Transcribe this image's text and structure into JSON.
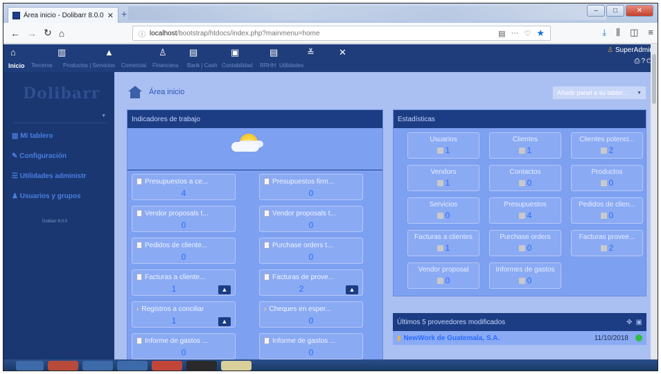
{
  "browser": {
    "tab_title": "Área inicio - Dolibarr 8.0.0",
    "url_host": "localhost",
    "url_path": "/bootstrap/htdocs/index.php?mainmenu=home"
  },
  "topmenu": {
    "items": [
      "Inicio",
      "Terceros",
      "Productos | Servicios",
      "Comercial",
      "Financiera",
      "Bank | Cash",
      "Contabilidad",
      "RRHH",
      "Utilidades"
    ],
    "user": "SuperAdmin"
  },
  "sidebar": {
    "logo": "Dolibarr",
    "items": [
      {
        "label": "Mi tablero",
        "icon": "chart-icon"
      },
      {
        "label": "Configuración",
        "icon": "wrench-icon"
      },
      {
        "label": "Utilidades administr",
        "icon": "list-icon"
      },
      {
        "label": "Usuarios y grupos",
        "icon": "users-icon"
      }
    ],
    "version": "Dolibarr 8.0.0"
  },
  "main": {
    "breadcrumb": "Área inicio",
    "add_panel_placeholder": "Añadir panel a su tabler...",
    "work_panel": {
      "title": "Indicadores de trabajo",
      "boxes": [
        {
          "label": "Presupuestos a ce...",
          "value": "4",
          "warning": false
        },
        {
          "label": "Presupuestos firm...",
          "value": "0",
          "warning": false
        },
        {
          "label": "Vendor proposals t...",
          "value": "0",
          "warning": false
        },
        {
          "label": "Vendor proposals t...",
          "value": "0",
          "warning": false
        },
        {
          "label": "Pedidos de cliente...",
          "value": "0",
          "warning": false
        },
        {
          "label": "Purchase orders t...",
          "value": "0",
          "warning": false
        },
        {
          "label": "Facturas a cliente...",
          "value": "1",
          "warning": true
        },
        {
          "label": "Facturas de prove...",
          "value": "2",
          "warning": true
        },
        {
          "label": "Registros a conciliar",
          "value": "1",
          "warning": true
        },
        {
          "label": "Cheques en esper...",
          "value": "0",
          "warning": false
        },
        {
          "label": "Informe de gastos ...",
          "value": "0",
          "warning": false
        },
        {
          "label": "Informe de gastos ...",
          "value": "0",
          "warning": false
        }
      ]
    },
    "stats_panel": {
      "title": "Estadísticas",
      "items": [
        {
          "label": "Usuarios",
          "value": "1"
        },
        {
          "label": "Clientes",
          "value": "1"
        },
        {
          "label": "Clientes potenci...",
          "value": "2"
        },
        {
          "label": "Vendors",
          "value": "1"
        },
        {
          "label": "Contactos",
          "value": "0"
        },
        {
          "label": "Productos",
          "value": "0"
        },
        {
          "label": "Servicios",
          "value": "0"
        },
        {
          "label": "Presupuestos",
          "value": "4"
        },
        {
          "label": "Pedidos de clien...",
          "value": "0"
        },
        {
          "label": "Facturas a clientes",
          "value": "1"
        },
        {
          "label": "Purchase orders",
          "value": "0"
        },
        {
          "label": "Facturas provee...",
          "value": "2"
        },
        {
          "label": "Vendor proposal",
          "value": "0"
        },
        {
          "label": "Informes de gastos",
          "value": "0"
        }
      ]
    },
    "suppliers_panel": {
      "title": "Últimos 5 proveedores modificados",
      "rows": [
        {
          "name": "NewWork de Guatemala, S.A.",
          "date": "11/10/2018",
          "status_color": "#2fbf3f"
        }
      ]
    }
  }
}
